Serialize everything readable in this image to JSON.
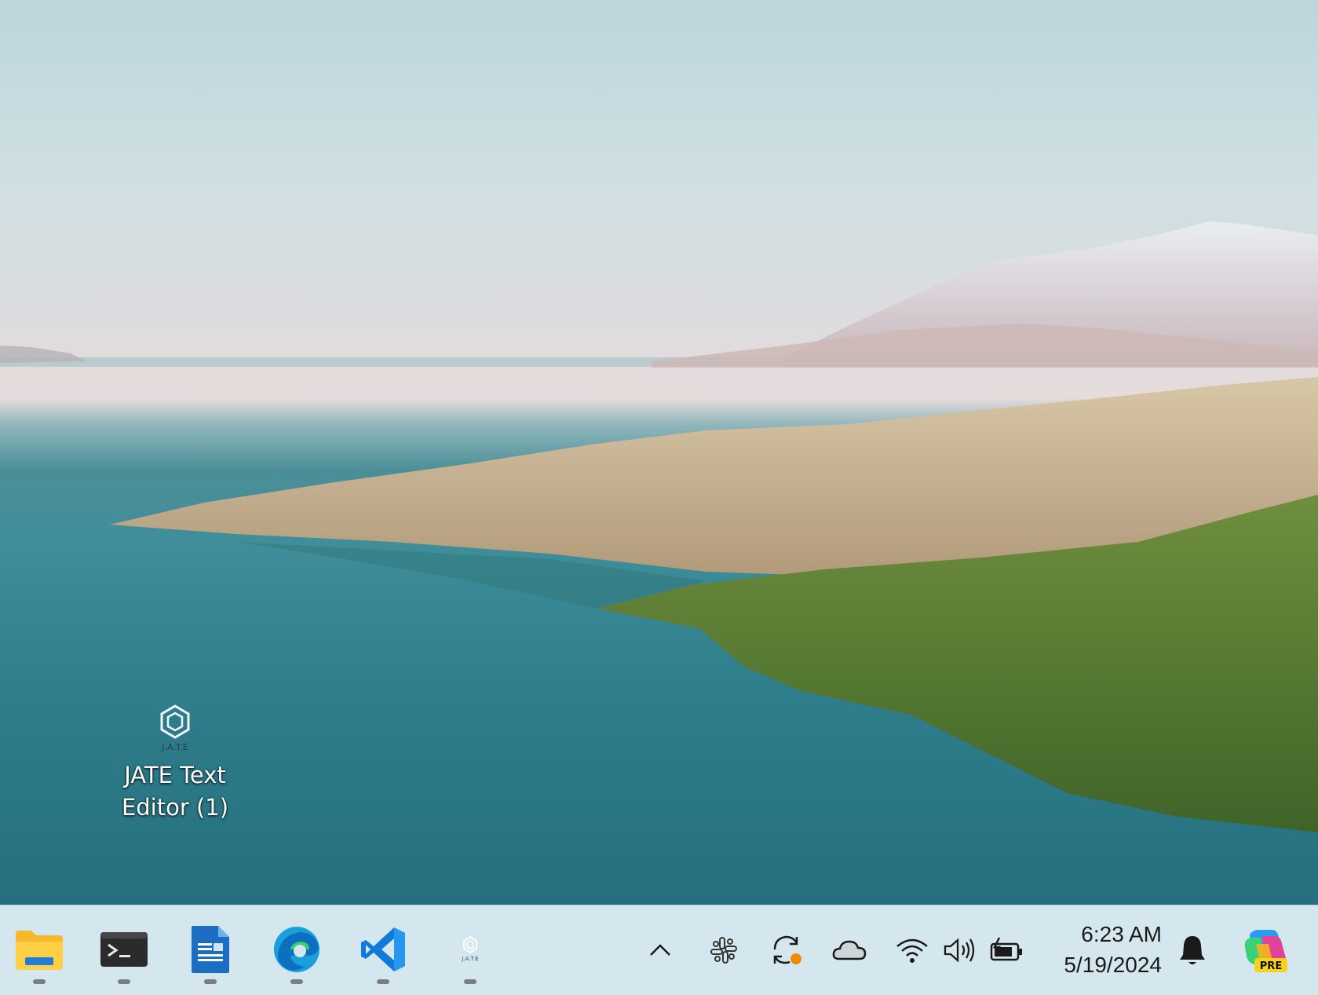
{
  "desktop": {
    "icons": [
      {
        "label": "JATE Text Editor (1)",
        "logo_text": "J.A.T.E"
      }
    ]
  },
  "taskbar": {
    "apps": [
      {
        "name": "File Explorer",
        "icon": "folder-icon"
      },
      {
        "name": "Terminal",
        "icon": "terminal-icon"
      },
      {
        "name": "Writer",
        "icon": "document-icon"
      },
      {
        "name": "Edge",
        "icon": "edge-icon"
      },
      {
        "name": "Visual Studio Code",
        "icon": "vscode-icon"
      },
      {
        "name": "JATE",
        "icon": "jate-icon",
        "logo_text": "J.A.T.E"
      }
    ],
    "tray": {
      "icons": [
        "chevron-up-icon",
        "slack-icon",
        "sync-icon",
        "cloud-icon",
        "wifi-icon",
        "volume-icon",
        "battery-icon"
      ],
      "time": "6:23 AM",
      "date": "5/19/2024",
      "copilot_badge": "PRE"
    }
  }
}
